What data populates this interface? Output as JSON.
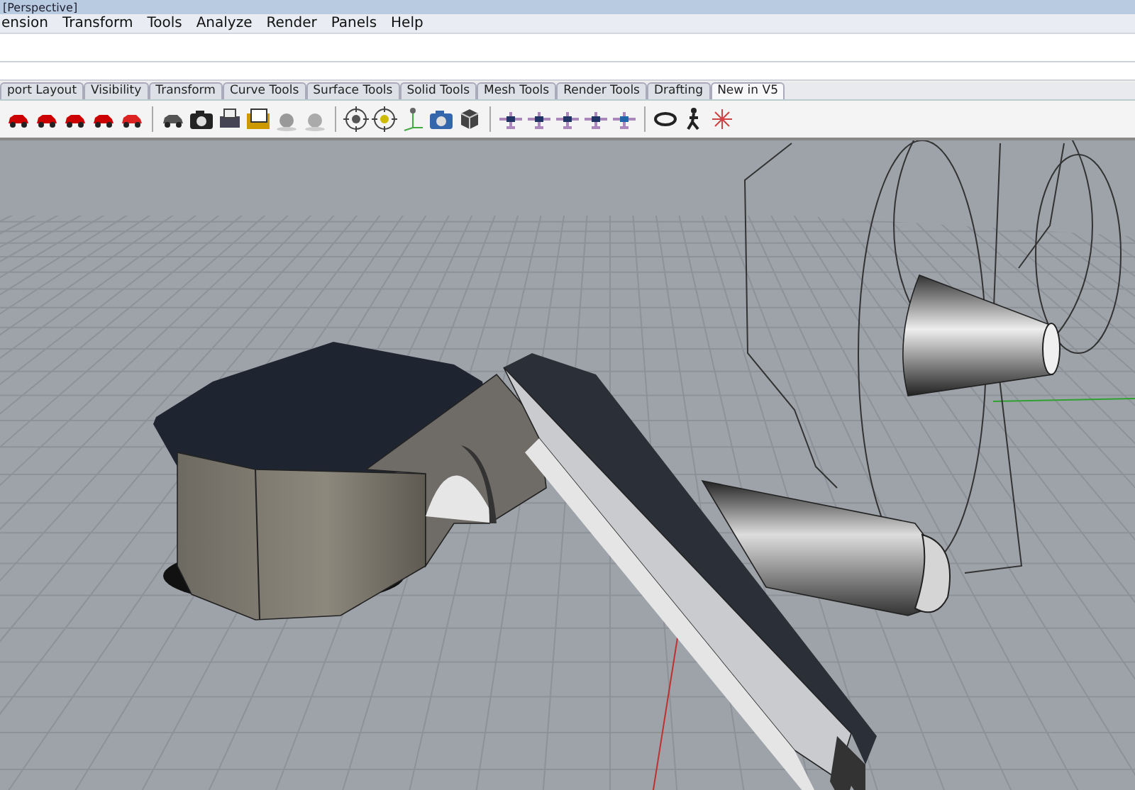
{
  "window": {
    "title": "[Perspective]"
  },
  "menu": [
    "ension",
    "Transform",
    "Tools",
    "Analyze",
    "Render",
    "Panels",
    "Help"
  ],
  "tabs": [
    {
      "label": "port Layout",
      "selected": false
    },
    {
      "label": "Visibility",
      "selected": false
    },
    {
      "label": "Transform",
      "selected": false
    },
    {
      "label": "Curve Tools",
      "selected": false
    },
    {
      "label": "Surface Tools",
      "selected": false
    },
    {
      "label": "Solid Tools",
      "selected": false
    },
    {
      "label": "Mesh Tools",
      "selected": false
    },
    {
      "label": "Render Tools",
      "selected": false
    },
    {
      "label": "Drafting",
      "selected": false
    },
    {
      "label": "New in V5",
      "selected": true
    }
  ]
}
